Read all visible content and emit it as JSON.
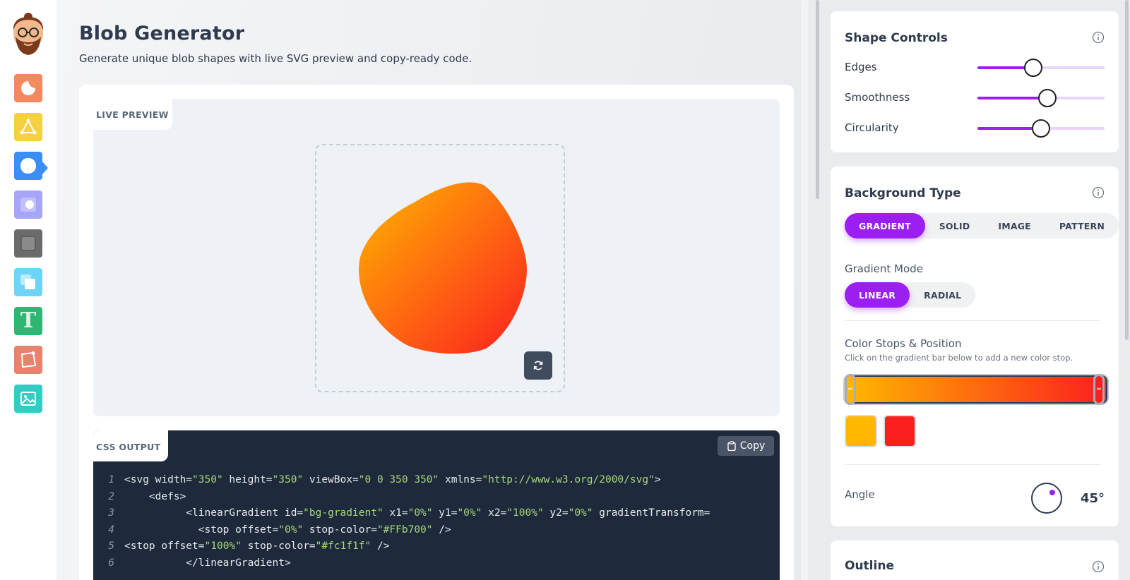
{
  "header": {
    "title": "Blob Generator",
    "subtitle": "Generate unique blob shapes with live SVG preview and copy-ready code."
  },
  "sidebar": {
    "items": [
      {
        "name": "blob-tool",
        "color": "#f4895f",
        "active": false
      },
      {
        "name": "triangle-tool",
        "color": "#f5d142",
        "active": false
      },
      {
        "name": "blob-shape-tool",
        "color": "#3b8ef6",
        "active": true
      },
      {
        "name": "neumorphism-tool",
        "color": "#a7a5f7",
        "active": false
      },
      {
        "name": "shadow-tool",
        "color": "#6b6b6b",
        "active": false
      },
      {
        "name": "glass-tool",
        "color": "#6dd3f7",
        "active": false
      },
      {
        "name": "text-tool",
        "color": "#2fb673",
        "active": false
      },
      {
        "name": "clip-path-tool",
        "color": "#e7826d",
        "active": false
      },
      {
        "name": "image-tool",
        "color": "#34cbc3",
        "active": false
      }
    ],
    "text_tool_glyph": "T"
  },
  "preview": {
    "tab_label": "LIVE PREVIEW"
  },
  "code": {
    "tab_label": "CSS OUTPUT",
    "copy_label": "Copy",
    "lines": [
      {
        "n": "1",
        "text": "<svg width=\"350\" height=\"350\" viewBox=\"0 0 350 350\" xmlns=\"http://www.w3.org/2000/svg\">"
      },
      {
        "n": "2",
        "text": "    <defs>"
      },
      {
        "n": "3",
        "text": "          <linearGradient id=\"bg-gradient\" x1=\"0%\" y1=\"0%\" x2=\"100%\" y2=\"0%\" gradientTransform="
      },
      {
        "n": "4",
        "text": "            <stop offset=\"0%\" stop-color=\"#FFb700\" />"
      },
      {
        "n": "5",
        "text": "<stop offset=\"100%\" stop-color=\"#fc1f1f\" />"
      },
      {
        "n": "6",
        "text": "          </linearGradient>"
      }
    ]
  },
  "shape_controls": {
    "title": "Shape Controls",
    "sliders": [
      {
        "label": "Edges",
        "value_fraction": 0.44
      },
      {
        "label": "Smoothness",
        "value_fraction": 0.55
      },
      {
        "label": "Circularity",
        "value_fraction": 0.5
      }
    ]
  },
  "background": {
    "title": "Background Type",
    "types": [
      "GRADIENT",
      "SOLID",
      "IMAGE",
      "PATTERN"
    ],
    "active_type": "GRADIENT",
    "gradient_mode_label": "Gradient Mode",
    "modes": [
      "LINEAR",
      "RADIAL"
    ],
    "active_mode": "LINEAR",
    "color_stops_label": "Color Stops & Position",
    "color_stops_hint": "Click on the gradient bar below to add a new color stop.",
    "stops": [
      {
        "color": "#ffb700",
        "position": 0
      },
      {
        "color": "#fc1f1f",
        "position": 100
      }
    ],
    "angle_label": "Angle",
    "angle_value": "45°"
  },
  "outline": {
    "title": "Outline"
  },
  "colors": {
    "accent": "#9a1ff0",
    "gradient_start": "#ffb700",
    "gradient_end": "#fc1f1f"
  }
}
